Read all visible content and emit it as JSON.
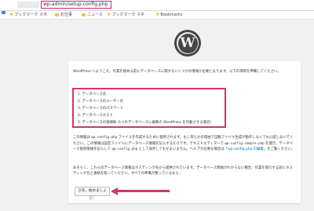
{
  "browser": {
    "url": "wp-admin/setup-config.php",
    "accent_color": "#e0197b"
  },
  "bookmarks": [
    {
      "label": "ブックマーク マネ"
    },
    {
      "label": "お仕事"
    },
    {
      "label": "ニュース"
    },
    {
      "label": "ブックマーク マネ"
    },
    {
      "label": "Bookmarks"
    }
  ],
  "logo": {
    "letter": "W"
  },
  "setup": {
    "intro": "WordPress へようこそ。作業を始める前にデータベースに関するいくつかの情報が必要となります。以下の項目を準備してください。",
    "items": [
      "1. データベース名",
      "2. データベースのユーザー名",
      "3. データベースのパスワード",
      "4. データベースホスト",
      "5. データベースの接頭辞 (1つのデータベースに複数の WordPress を作動させる場合)"
    ],
    "note_part1": "この情報は ",
    "note_code1": "wp-config.php",
    "note_part2": " ファイルを作成するために使用されます。もし何らかの理由で自動ファイル生成が動作しなくても心配しないでください。この情報は設定ファイルにデータベース情報を記入するだけです。テキストエディターで ",
    "note_code2": "wp-config-sample.php",
    "note_part3": " を開き、データベース接続情報を記入して ",
    "note_code3": "wp-config.php",
    "note_part4": " として保存してもかまいません。ヘルプが必要な場合は",
    "note_link": "「wp-config.php の編集」",
    "note_part5": "をご覧ください。",
    "note2": "おそらく、これらのデータベース情報はホスティング先から提供されています。データベース情報がわからない場合、作業を続行する前にホスティング先と連絡を取ってください。すべての準備が整っているなら…",
    "button_label": "さあ、始めましょう！"
  }
}
